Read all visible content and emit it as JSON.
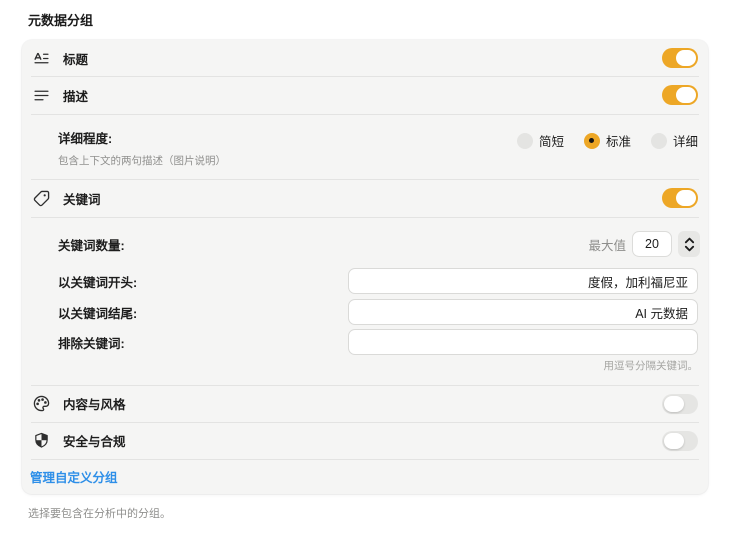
{
  "page": {
    "title": "元数据分组",
    "footer_note": "选择要包含在分析中的分组。"
  },
  "colors": {
    "accent": "#eda726",
    "toggle_off": "#e5e5e3",
    "link": "#2e8fe8",
    "panel_bg": "#f5f5f4"
  },
  "groups": {
    "title": {
      "label": "标题",
      "icon": "letter-text-icon",
      "enabled": true
    },
    "description": {
      "label": "描述",
      "icon": "align-left-icon",
      "enabled": true
    },
    "keywords": {
      "label": "关键词",
      "icon": "tag-icon",
      "enabled": true
    },
    "content_style": {
      "label": "内容与风格",
      "icon": "palette-icon",
      "enabled": false
    },
    "safety": {
      "label": "安全与合规",
      "icon": "shield-icon",
      "enabled": false
    }
  },
  "detail_level": {
    "label": "详细程度:",
    "description": "包含上下文的两句描述（图片说明）",
    "options": [
      {
        "label": "简短",
        "selected": false
      },
      {
        "label": "标准",
        "selected": true
      },
      {
        "label": "详细",
        "selected": false
      }
    ]
  },
  "keyword_settings": {
    "count": {
      "label": "关键词数量:",
      "max_label": "最大值",
      "value": "20"
    },
    "start_with": {
      "label": "以关键词开头:",
      "value": "度假，加利福尼亚"
    },
    "end_with": {
      "label": "以关键词结尾:",
      "value": "AI 元数据"
    },
    "exclude": {
      "label": "排除关键词:",
      "value": ""
    },
    "hint": "用逗号分隔关键词。"
  },
  "manage_link": "管理自定义分组"
}
